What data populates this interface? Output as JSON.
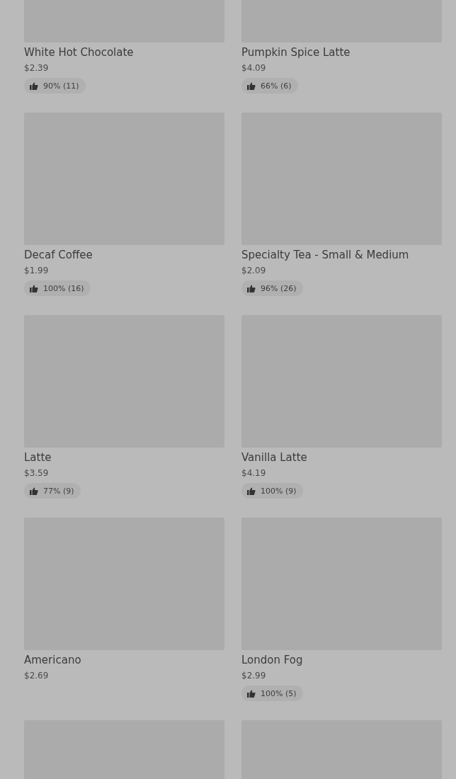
{
  "items": [
    {
      "kind": "item",
      "name": "White Hot Chocolate",
      "price": "$2.39",
      "rating": "90% (11)"
    },
    {
      "kind": "item",
      "name": "Pumpkin Spice Latte",
      "price": "$4.09",
      "rating": "66% (6)"
    },
    {
      "kind": "item",
      "name": "Decaf Coffee",
      "price": "$1.99",
      "rating": "100% (16)"
    },
    {
      "kind": "item",
      "name": "Specialty Tea - Small & Medium",
      "price": "$2.09",
      "rating": "96% (26)"
    },
    {
      "kind": "item",
      "name": "Latte",
      "price": "$3.59",
      "rating": "77% (9)"
    },
    {
      "kind": "item",
      "name": "Vanilla Latte",
      "price": "$4.19",
      "rating": "100% (9)"
    },
    {
      "kind": "item",
      "name": "Americano",
      "price": "$2.69"
    },
    {
      "kind": "item",
      "name": "London Fog",
      "price": "$2.99",
      "rating": "100% (5)"
    },
    {
      "kind": "image-only"
    },
    {
      "kind": "image-only"
    }
  ]
}
